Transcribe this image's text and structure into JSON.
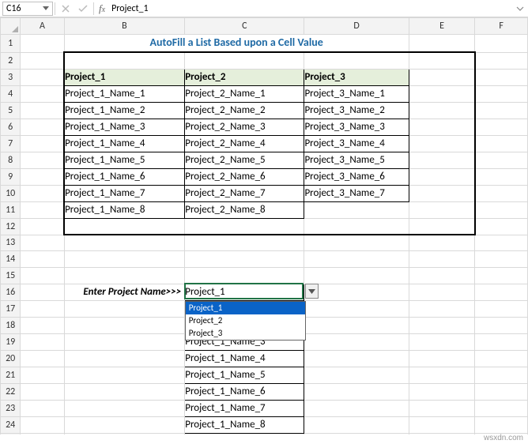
{
  "name_box": "C16",
  "formula": "Project_1",
  "col_headers": [
    "A",
    "B",
    "C",
    "D",
    "E",
    "F"
  ],
  "row_headers": [
    "1",
    "2",
    "3",
    "4",
    "5",
    "6",
    "7",
    "8",
    "9",
    "10",
    "11",
    "12",
    "13",
    "14",
    "15",
    "16",
    "17",
    "18",
    "19",
    "20",
    "21",
    "22",
    "23",
    "24"
  ],
  "title": "AutoFill a List Based upon a Cell Value",
  "table": {
    "headers": [
      "Project_1",
      "Project_2",
      "Project_3"
    ],
    "rows": [
      [
        "Project_1_Name_1",
        "Project_2_Name_1",
        "Project_3_Name_1"
      ],
      [
        "Project_1_Name_2",
        "Project_2_Name_2",
        "Project_3_Name_2"
      ],
      [
        "Project_1_Name_3",
        "Project_2_Name_3",
        "Project_3_Name_3"
      ],
      [
        "Project_1_Name_4",
        "Project_2_Name_4",
        "Project_3_Name_4"
      ],
      [
        "Project_1_Name_5",
        "Project_2_Name_5",
        "Project_3_Name_5"
      ],
      [
        "Project_1_Name_6",
        "Project_2_Name_6",
        "Project_3_Name_6"
      ],
      [
        "Project_1_Name_7",
        "Project_2_Name_7",
        "Project_3_Name_7"
      ],
      [
        "Project_1_Name_8",
        "Project_2_Name_8",
        ""
      ]
    ]
  },
  "prompt_label": "Enter Project Name>>>",
  "dv_value": "Project_1",
  "dv_options": [
    "Project_1",
    "Project_2",
    "Project_3"
  ],
  "result_list": [
    "Project_1_Name_3",
    "Project_1_Name_4",
    "Project_1_Name_5",
    "Project_1_Name_6",
    "Project_1_Name_7",
    "Project_1_Name_8"
  ],
  "watermark": "wsxdn.com"
}
